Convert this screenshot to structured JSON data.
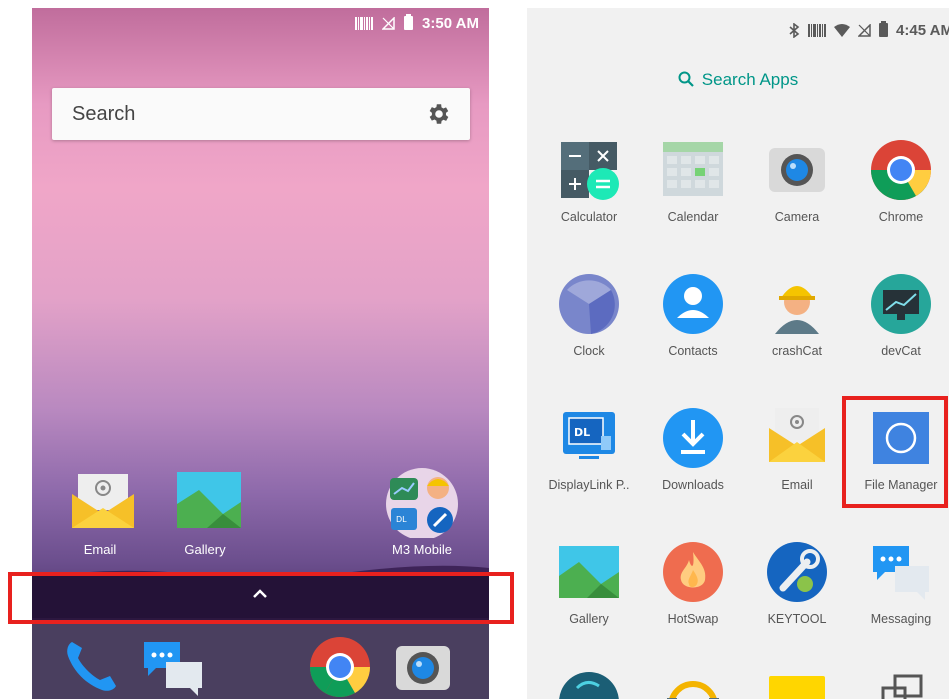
{
  "left": {
    "status": {
      "time": "3:50 AM"
    },
    "search": {
      "placeholder": "Search"
    },
    "home_icons": [
      {
        "label": "Email",
        "icon": "email-icon"
      },
      {
        "label": "Gallery",
        "icon": "gallery-icon"
      },
      {
        "label": "M3 Mobile",
        "icon": "folder-icon"
      }
    ],
    "dock": [
      "phone-icon",
      "messaging-icon",
      "chrome-icon",
      "camera-icon"
    ]
  },
  "right": {
    "status": {
      "time": "4:45 AM"
    },
    "search_label": "Search Apps",
    "apps": [
      {
        "name": "Calculator",
        "icon": "calculator-icon"
      },
      {
        "name": "Calendar",
        "icon": "calendar-icon"
      },
      {
        "name": "Camera",
        "icon": "camera-icon"
      },
      {
        "name": "Chrome",
        "icon": "chrome-icon"
      },
      {
        "name": "Clock",
        "icon": "clock-icon"
      },
      {
        "name": "Contacts",
        "icon": "contacts-icon"
      },
      {
        "name": "crashCat",
        "icon": "crashcat-icon"
      },
      {
        "name": "devCat",
        "icon": "devcat-icon"
      },
      {
        "name": "DisplayLink P..",
        "icon": "displaylink-icon"
      },
      {
        "name": "Downloads",
        "icon": "downloads-icon"
      },
      {
        "name": "Email",
        "icon": "email-icon"
      },
      {
        "name": "File Manager",
        "icon": "file-manager-icon"
      },
      {
        "name": "Gallery",
        "icon": "gallery-icon"
      },
      {
        "name": "HotSwap",
        "icon": "hotswap-icon"
      },
      {
        "name": "KEYTOOL",
        "icon": "keytool-icon"
      },
      {
        "name": "Messaging",
        "icon": "messaging-icon"
      }
    ]
  },
  "colors": {
    "highlight": "#e8211e",
    "accent_teal": "#009688",
    "wallpaper_pink": "#f0a6c8",
    "wallpaper_purple": "#2d1d48"
  }
}
